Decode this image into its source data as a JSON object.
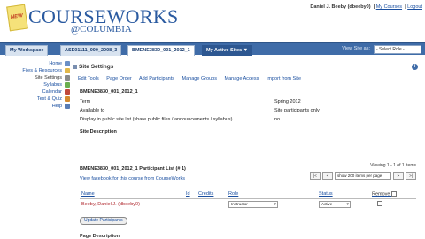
{
  "header": {
    "logo_badge": "NEW",
    "logo_title": "COURSEWORKS",
    "logo_subtitle": "@COLUMBIA",
    "user_name": "Daniel J. Beeby (dbeeby0)",
    "my_courses": "My Courses",
    "logout": "Logout"
  },
  "tabs": [
    {
      "label": "My Workspace"
    },
    {
      "label": "ASE01111_000_2008_3"
    },
    {
      "label": "BMENE3830_001_2012_1"
    },
    {
      "label": "My Active Sites ▼"
    }
  ],
  "view_site_as": "View Site as:",
  "role_select": "- Select Role -",
  "left_nav": [
    {
      "label": "Home",
      "icon": "home-icon",
      "color": "#6a8fc7"
    },
    {
      "label": "Files & Resources",
      "icon": "folder-icon",
      "color": "#e2b84a"
    },
    {
      "label": "Site Settings",
      "icon": "settings-icon",
      "color": "#8a8a8a"
    },
    {
      "label": "Syllabus",
      "icon": "syllabus-icon",
      "color": "#6bae4f"
    },
    {
      "label": "Calendar",
      "icon": "calendar-icon",
      "color": "#c0483a"
    },
    {
      "label": "Test & Quiz",
      "icon": "quiz-icon",
      "color": "#d48a2f"
    },
    {
      "label": "Help",
      "icon": "help-icon",
      "color": "#5a7db4"
    }
  ],
  "tool": {
    "title": "Site Settings",
    "actions": [
      "Edit Tools",
      "Page Order",
      "Add Participants",
      "Manage Groups",
      "Manage Access",
      "Import from Site"
    ]
  },
  "site": {
    "name": "BMENE3830_001_2012_1",
    "rows": [
      {
        "key": "Term",
        "value": "Spring 2012"
      },
      {
        "key": "Available to",
        "value": "Site participants only"
      },
      {
        "key": "Display in public site list (share public files / announcements / syllabus)",
        "value": "no"
      },
      {
        "key": "Site Description",
        "value": ""
      }
    ]
  },
  "participants": {
    "title": "BMENE3830_001_2012_1 Participant List (# 1)",
    "viewing": "Viewing 1 - 1 of 1 items",
    "facebook_link": "View facebook for this course from CourseWorks",
    "pager": {
      "first": "|<",
      "prev": "<",
      "page_size": "show 200 items per page",
      "next": ">",
      "last": ">|"
    },
    "columns": [
      "Name",
      "Id",
      "Credits",
      "Role",
      "Status",
      "Remove"
    ],
    "rows": [
      {
        "name": "Beeby, Daniel J. (dbeeby0)",
        "id": "",
        "credits": "",
        "role": "Instructor",
        "status": "Active"
      }
    ],
    "update_button": "Update Participants"
  },
  "bottom_heading": "Page Description"
}
